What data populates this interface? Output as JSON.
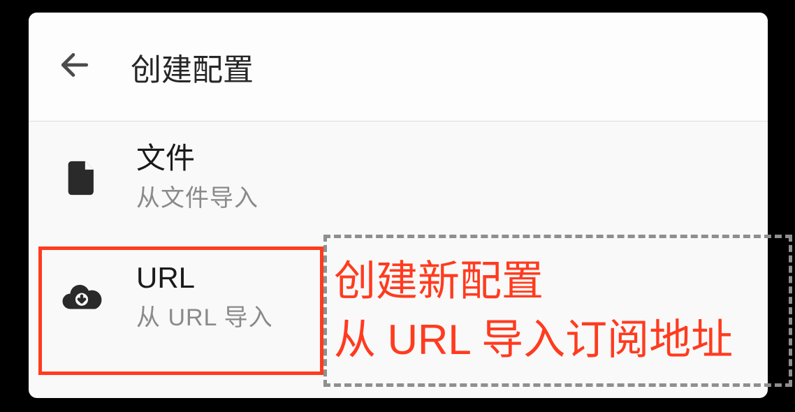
{
  "header": {
    "title": "创建配置"
  },
  "items": [
    {
      "title": "文件",
      "subtitle": "从文件导入"
    },
    {
      "title": "URL",
      "subtitle": "从 URL 导入"
    }
  ],
  "annotation": {
    "line1": "创建新配置",
    "line2": "从 URL 导入订阅地址"
  }
}
